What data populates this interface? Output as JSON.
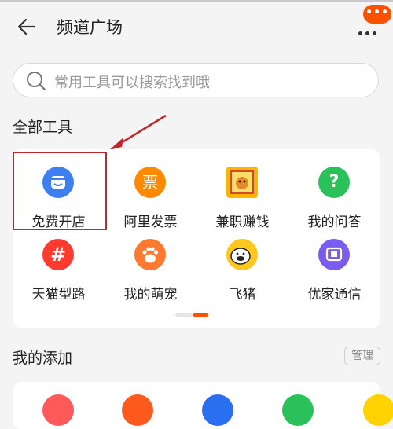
{
  "header": {
    "title": "频道广场",
    "badge": "•••"
  },
  "search": {
    "placeholder": "常用工具可以搜索找到哦"
  },
  "all_tools": {
    "title": "全部工具",
    "items": [
      {
        "label": "免费开店",
        "icon": "shop-icon",
        "color": "#3d7ff0"
      },
      {
        "label": "阿里发票",
        "icon": "invoice-icon",
        "color": "#ff8a00",
        "glyph": "票"
      },
      {
        "label": "兼职赚钱",
        "icon": "part-time-icon",
        "color": "#ffb400"
      },
      {
        "label": "我的问答",
        "icon": "question-icon",
        "color": "#2bc15a",
        "glyph": "?"
      },
      {
        "label": "天猫型路",
        "icon": "tmall-icon",
        "color": "#ff3b30",
        "glyph": "#"
      },
      {
        "label": "我的萌宠",
        "icon": "paw-icon",
        "color": "#ff7a2e"
      },
      {
        "label": "飞猪",
        "icon": "fliggy-icon",
        "color": "#ffc81e"
      },
      {
        "label": "优家通信",
        "icon": "telecom-icon",
        "color": "#7b5cf0"
      }
    ]
  },
  "my_added": {
    "title": "我的添加",
    "manage_label": "管理",
    "items": [
      {
        "icon": "flower-icon",
        "color": "#ff5a5a"
      },
      {
        "icon": "phone-charge-icon",
        "color": "#ff5a1e"
      },
      {
        "icon": "robot-icon",
        "color": "#2a6ff0"
      },
      {
        "icon": "tree-icon",
        "color": "#2bc15a"
      },
      {
        "icon": "character-icon",
        "color": "#ffd200"
      }
    ]
  }
}
